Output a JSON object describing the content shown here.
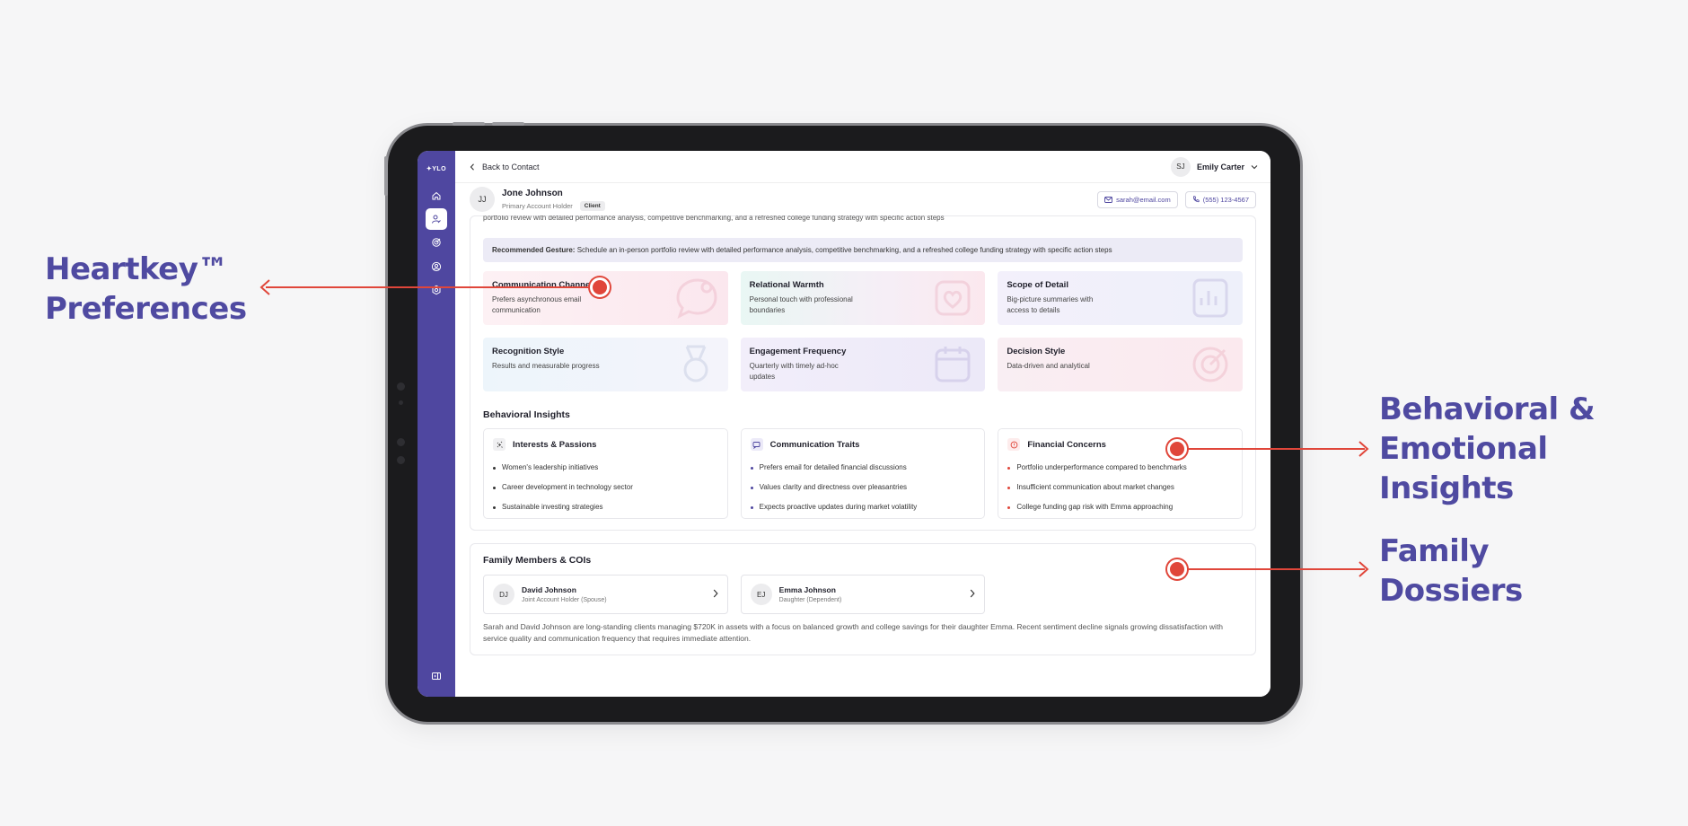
{
  "callouts": {
    "heartkey": [
      "Heartkey™",
      "Preferences"
    ],
    "behavioral": [
      "Behavioral &",
      "Emotional",
      "Insights"
    ],
    "family": [
      "Family",
      "Dossiers"
    ]
  },
  "colors": {
    "accent": "#4f47a0",
    "annotation": "#e0463a",
    "callout_text": "#4f4aa1"
  },
  "sidebar": {
    "logo": "✦YLO",
    "items": [
      {
        "icon": "home-icon"
      },
      {
        "icon": "contact-edit-icon",
        "active": true
      },
      {
        "icon": "target-icon"
      },
      {
        "icon": "user-circle-icon"
      },
      {
        "icon": "settings-icon"
      }
    ],
    "footer_icon": "panel-toggle-icon"
  },
  "topbar": {
    "back_label": "Back to Contact",
    "user_initials": "SJ",
    "user_name": "Emily Carter"
  },
  "profile": {
    "initials": "JJ",
    "name": "Jone Johnson",
    "role": "Primary Account Holder",
    "badge": "Client",
    "email": "sarah@email.com",
    "phone": "(555) 123-4567"
  },
  "clipped_text": "portfolio review with detailed performance analysis, competitive benchmarking, and a refreshed college funding strategy with specific action steps",
  "gesture": {
    "label": "Recommended Gesture:",
    "text": " Schedule an in-person portfolio review with detailed performance analysis, competitive benchmarking, and a refreshed college funding strategy with specific action steps"
  },
  "preferences": [
    {
      "title": "Communication Channel",
      "desc": "Prefers asynchronous email communication",
      "icon": "chat-bubble-icon"
    },
    {
      "title": "Relational Warmth",
      "desc": "Personal touch with professional boundaries",
      "icon": "heart-card-icon"
    },
    {
      "title": "Scope of Detail",
      "desc": "Big-picture summaries with access to details",
      "icon": "chart-doc-icon"
    },
    {
      "title": "Recognition Style",
      "desc": "Results and measurable progress",
      "icon": "medal-icon"
    },
    {
      "title": "Engagement Frequency",
      "desc": "Quarterly with timely ad-hoc updates",
      "icon": "calendar-icon"
    },
    {
      "title": "Decision Style",
      "desc": "Data-driven and analytical",
      "icon": "target-icon"
    }
  ],
  "behavioral": {
    "title": "Behavioral Insights",
    "cards": [
      {
        "title": "Interests & Passions",
        "icon": "sparkle-icon",
        "items": [
          "Women's leadership initiatives",
          "Career development in technology sector",
          "Sustainable investing strategies"
        ]
      },
      {
        "title": "Communication Traits",
        "icon": "message-icon",
        "items": [
          "Prefers email for detailed financial discussions",
          "Values clarity and directness over pleasantries",
          "Expects proactive updates during market volatility"
        ]
      },
      {
        "title": "Financial Concerns",
        "icon": "alert-icon",
        "items": [
          "Portfolio underperformance compared to benchmarks",
          "Insufficient communication about market changes",
          "College funding gap risk with Emma approaching"
        ]
      }
    ]
  },
  "family": {
    "title": "Family Members & COIs",
    "members": [
      {
        "initials": "DJ",
        "name": "David Johnson",
        "role": "Joint Account Holder (Spouse)"
      },
      {
        "initials": "EJ",
        "name": "Emma Johnson",
        "role": "Daughter (Dependent)"
      }
    ],
    "summary": "Sarah and David Johnson are long-standing clients managing $720K in assets with a focus on balanced growth and college savings for their daughter Emma. Recent sentiment decline signals growing dissatisfaction with service quality and communication frequency that requires immediate attention."
  }
}
